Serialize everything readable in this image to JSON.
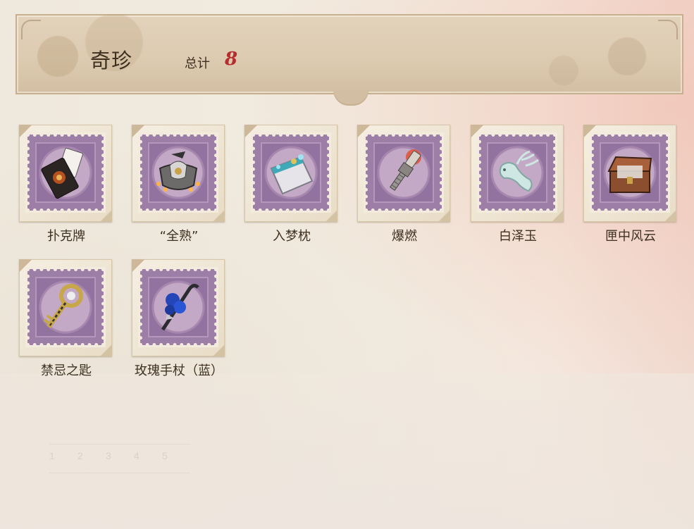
{
  "header": {
    "title": "奇珍",
    "total_label": "总计",
    "total_count": "8"
  },
  "items": [
    {
      "name": "扑克牌",
      "icon": "playing-cards-icon"
    },
    {
      "name": "“全熟”",
      "icon": "grill-mask-icon"
    },
    {
      "name": "入梦枕",
      "icon": "dream-pillow-icon"
    },
    {
      "name": "爆燃",
      "icon": "spark-plug-icon"
    },
    {
      "name": "白泽玉",
      "icon": "jade-deer-icon"
    },
    {
      "name": "匣中风云",
      "icon": "treasure-chest-icon"
    },
    {
      "name": "禁忌之匙",
      "icon": "forbidden-key-icon"
    },
    {
      "name": "玫瑰手杖（蓝）",
      "icon": "blue-rose-cane-icon"
    }
  ],
  "colors": {
    "stamp_purple": "#9d7ea6",
    "count_red": "#b52d2d",
    "text_brown": "#3d3020"
  }
}
